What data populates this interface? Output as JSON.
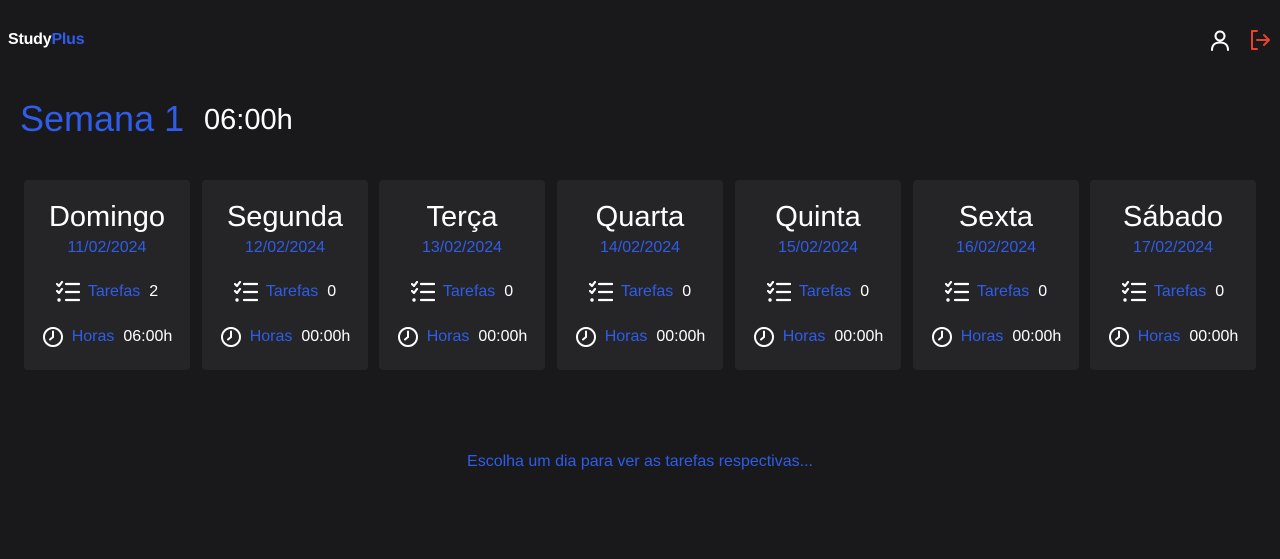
{
  "app": {
    "brand_primary": "Study",
    "brand_accent": "Plus",
    "accent_color": "#2f5ce8",
    "logout_color": "#e8412f"
  },
  "header_icons": [
    "user-icon",
    "logout-icon"
  ],
  "week": {
    "title": "Semana 1",
    "total_hours": "06:00h"
  },
  "labels": {
    "tasks": "Tarefas",
    "hours": "Horas"
  },
  "days": [
    {
      "name": "Domingo",
      "date": "11/02/2024",
      "tasks": "2",
      "hours": "06:00h"
    },
    {
      "name": "Segunda",
      "date": "12/02/2024",
      "tasks": "0",
      "hours": "00:00h"
    },
    {
      "name": "Terça",
      "date": "13/02/2024",
      "tasks": "0",
      "hours": "00:00h"
    },
    {
      "name": "Quarta",
      "date": "14/02/2024",
      "tasks": "0",
      "hours": "00:00h"
    },
    {
      "name": "Quinta",
      "date": "15/02/2024",
      "tasks": "0",
      "hours": "00:00h"
    },
    {
      "name": "Sexta",
      "date": "16/02/2024",
      "tasks": "0",
      "hours": "00:00h"
    },
    {
      "name": "Sábado",
      "date": "17/02/2024",
      "tasks": "0",
      "hours": "00:00h"
    }
  ],
  "hint": "Escolha um dia para ver as tarefas respectivas..."
}
